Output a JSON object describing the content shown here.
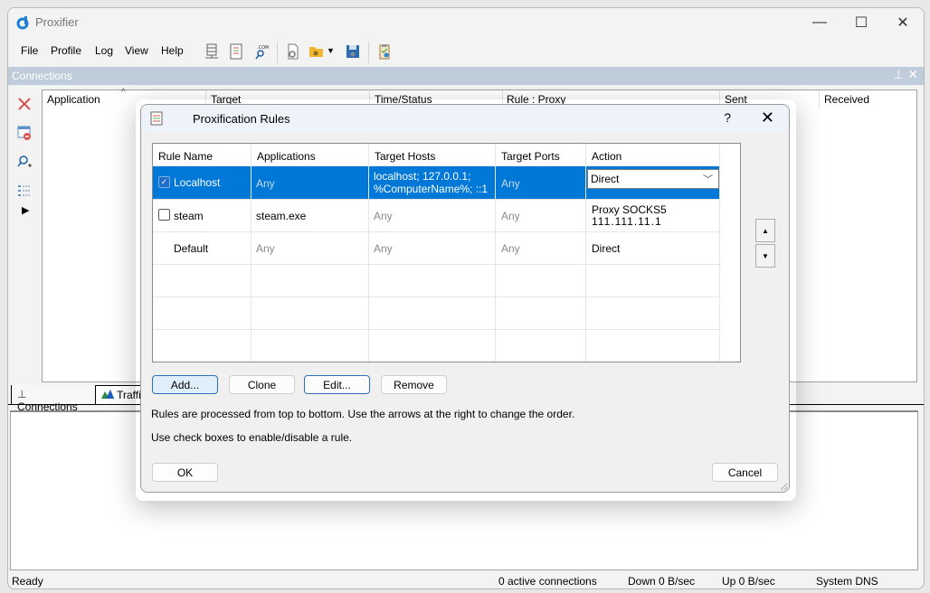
{
  "app": {
    "title": "Proxifier",
    "window_controls": {
      "minimize": "—",
      "maximize": "☐",
      "close": "✕"
    }
  },
  "menu": [
    "File",
    "Profile",
    "Log",
    "View",
    "Help"
  ],
  "toolbar": {
    "icons": [
      "proxy-servers-icon",
      "proxification-rules-icon",
      "name-resolution-icon",
      "advanced-settings-icon",
      "open-profile-icon",
      "save-profile-icon",
      "profile-clipboard-icon"
    ]
  },
  "connections_pane": {
    "title": "Connections",
    "pin": "⊥",
    "close": "✕",
    "columns": [
      "Application",
      "Target",
      "Time/Status",
      "Rule : Proxy",
      "Sent",
      "Received"
    ],
    "sort_indicator": "^"
  },
  "bottom_tabs": [
    "Connections",
    "Traffic"
  ],
  "statusbar": {
    "status": "Ready",
    "connections": "0 active connections",
    "down": "Down 0 B/sec",
    "up": "Up 0 B/sec",
    "dns": "System DNS"
  },
  "dialog": {
    "title": "Proxification Rules",
    "help": "?",
    "close": "✕",
    "columns": [
      "Rule Name",
      "Applications",
      "Target Hosts",
      "Target Ports",
      "Action"
    ],
    "rules": [
      {
        "enabled": true,
        "name": "Localhost",
        "applications": "Any",
        "hosts_line1": "localhost; 127.0.0.1;",
        "hosts_line2": "%ComputerName%; ::1",
        "ports": "Any",
        "action": "Direct",
        "selected": true
      },
      {
        "enabled": false,
        "name": "steam",
        "applications": "steam.exe",
        "hosts": "Any",
        "ports": "Any",
        "action_line1": "Proxy SOCKS5",
        "action_line2": "111.111.11.1"
      },
      {
        "name": "Default",
        "applications": "Any",
        "hosts": "Any",
        "ports": "Any",
        "action": "Direct"
      }
    ],
    "move_up": "▲",
    "move_down": "▼",
    "chevron": "﹀",
    "buttons": {
      "add": "Add...",
      "clone": "Clone",
      "edit": "Edit...",
      "remove": "Remove",
      "ok": "OK",
      "cancel": "Cancel"
    },
    "hint1": "Rules are processed from top to bottom. Use the arrows at the right to change the order.",
    "hint2": "Use check boxes to enable/disable a rule."
  }
}
